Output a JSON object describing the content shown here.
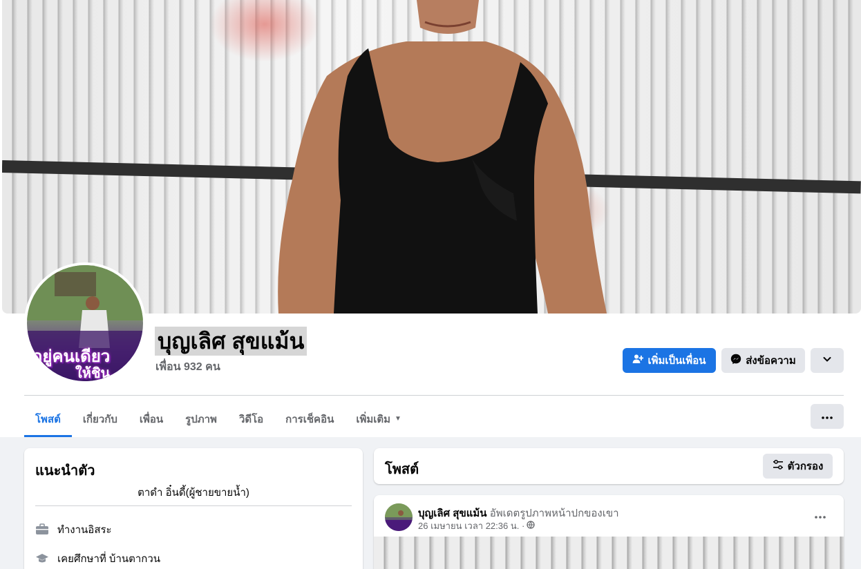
{
  "profile": {
    "name": "บุญเลิศ สุขแม้น",
    "friends_count": "เพื่อน 932 คน",
    "avatar_text_line1": "อยู่คนเดียว",
    "avatar_text_line2": "ให้ชิน.."
  },
  "actions": {
    "add_friend": "เพิ่มเป็นเพื่อน",
    "message": "ส่งข้อความ"
  },
  "tabs": [
    {
      "label": "โพสต์",
      "active": true
    },
    {
      "label": "เกี่ยวกับ",
      "active": false
    },
    {
      "label": "เพื่อน",
      "active": false
    },
    {
      "label": "รูปภาพ",
      "active": false
    },
    {
      "label": "วิดีโอ",
      "active": false
    },
    {
      "label": "การเช็คอิน",
      "active": false
    },
    {
      "label": "เพิ่มเติม",
      "active": false
    }
  ],
  "intro": {
    "title": "แนะนำตัว",
    "bio": "ตาดำ อิ๋นดี้(ผู้ชายขายน้ำ)",
    "work": "ทำงานอิสระ",
    "education": "เคยศึกษาที่ บ้านตากวน"
  },
  "posts_section": {
    "title": "โพสต์",
    "filter_label": "ตัวกรอง"
  },
  "post": {
    "author": "บุญเลิศ สุขแม้น",
    "action": "อัพเดตรูปภาพหน้าปกของเขา",
    "timestamp": "26 เมษายน เวลา 22:36 น. ·"
  },
  "colors": {
    "accent": "#1b74e4",
    "background": "#f0f2f5",
    "secondary_button": "#e4e6eb",
    "muted_text": "#65676b"
  }
}
